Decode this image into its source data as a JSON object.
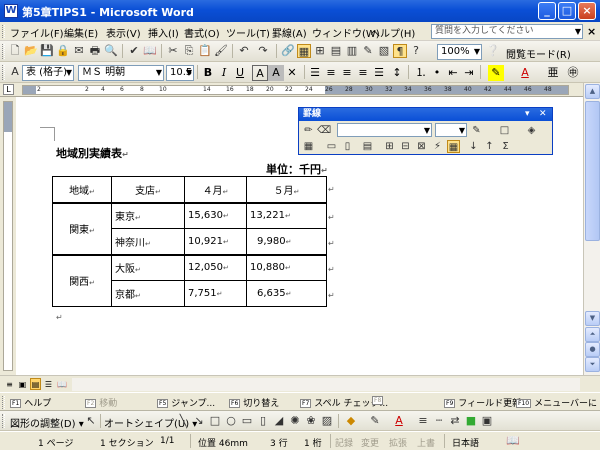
{
  "window": {
    "title": "第5章TIPS1 - Microsoft Word",
    "app_icon": "W"
  },
  "menu": {
    "items": [
      "ファイル(F)",
      "編集(E)",
      "表示(V)",
      "挿入(I)",
      "書式(O)",
      "ツール(T)",
      "罫線(A)",
      "ウィンドウ(W)",
      "ヘルプ(H)"
    ],
    "help_placeholder": "質問を入力してください"
  },
  "standard_toolbar": {
    "zoom": "100%",
    "reading_mode": "閲覧モード(R)"
  },
  "formatting_toolbar": {
    "style": "表 (格子)",
    "font": "ＭＳ 明朝",
    "size": "10.5"
  },
  "ruler": {
    "marks": [
      "2",
      "2",
      "4",
      "6",
      "8",
      "10",
      "14",
      "16",
      "18",
      "20",
      "22",
      "24",
      "26",
      "28",
      "30",
      "32",
      "34",
      "36",
      "38",
      "40",
      "42",
      "44",
      "46",
      "48"
    ]
  },
  "document": {
    "title": "地域別実績表",
    "unit_label": "単位：千円",
    "table": {
      "headers": [
        "地域",
        "支店",
        "４月",
        "５月"
      ],
      "groups": [
        {
          "region": "関東",
          "rows": [
            {
              "branch": "東京",
              "april": "15,630",
              "may": "13,221"
            },
            {
              "branch": "神奈川",
              "april": "10,921",
              "may": "9,980"
            }
          ]
        },
        {
          "region": "関西",
          "rows": [
            {
              "branch": "大阪",
              "april": "12,050",
              "may": "10,880"
            },
            {
              "branch": "京都",
              "april": "7,751",
              "may": "6,635"
            }
          ]
        }
      ]
    }
  },
  "palette": {
    "title": "罫線"
  },
  "fkeys": [
    {
      "key": "F1",
      "label": "ヘルプ",
      "enabled": true
    },
    {
      "key": "F2",
      "label": "移動",
      "enabled": false
    },
    {
      "key": "F5",
      "label": "ジャンプ...",
      "enabled": true
    },
    {
      "key": "F6",
      "label": "切り替え",
      "enabled": true
    },
    {
      "key": "F7",
      "label": "スペル チェック...",
      "enabled": true
    },
    {
      "key": "F8",
      "label": "",
      "enabled": false
    },
    {
      "key": "F9",
      "label": "フィールド更新",
      "enabled": true
    },
    {
      "key": "F10",
      "label": "メニューバーに",
      "enabled": true
    }
  ],
  "drawbar": {
    "draw_menu": "図形の調整(D)",
    "autoshape": "オートシェイプ(U)"
  },
  "status": {
    "page": "1 ページ",
    "section": "1 セクション",
    "page_of": "1/1",
    "position": "位置 46mm",
    "line": "3 行",
    "column": "1 桁",
    "rec": "記録",
    "trk": "変更",
    "ext": "拡張",
    "ovr": "上書",
    "language": "日本語"
  },
  "colors": {
    "titlebar": "#0a4fd6",
    "chrome": "#ece9d8",
    "ruler_gray": "#9aa6b8"
  }
}
